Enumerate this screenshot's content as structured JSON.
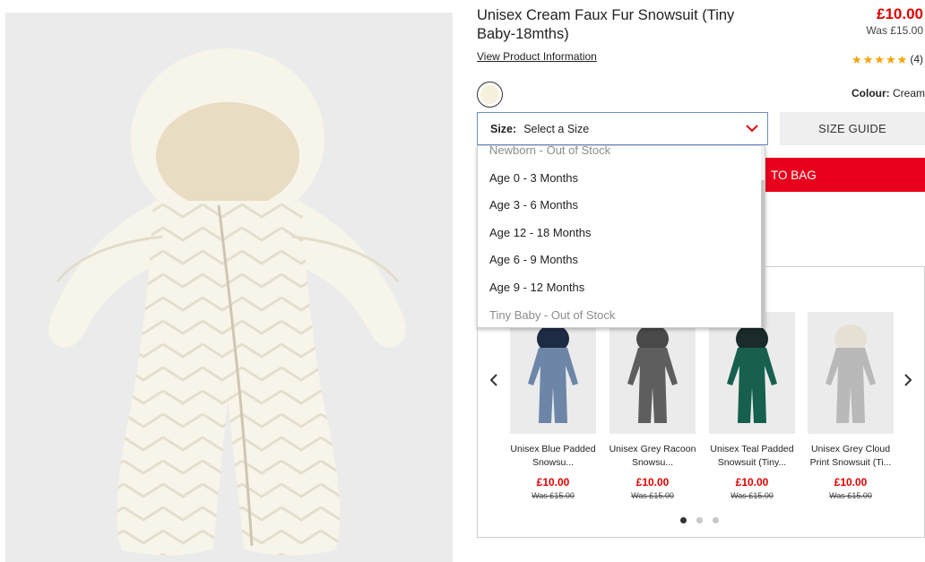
{
  "product": {
    "title": "Unisex Cream Faux Fur Snowsuit (Tiny Baby-18mths)",
    "view_info": "View Product Information",
    "price": "£10.00",
    "was_price": "Was £15.00",
    "rating_stars": 5,
    "rating_count": "(4)",
    "colour_label": "Colour:",
    "colour_value": "Cream",
    "swatch_color": "#f6f1dc"
  },
  "size": {
    "label": "Size:",
    "placeholder": "Select a Size",
    "guide_label": "SIZE GUIDE",
    "options": [
      {
        "label": "Newborn - Out of Stock",
        "available": false
      },
      {
        "label": "Age 0 - 3 Months",
        "available": true
      },
      {
        "label": "Age 3 - 6 Months",
        "available": true
      },
      {
        "label": "Age 12 - 18 Months",
        "available": true
      },
      {
        "label": "Age 6 - 9 Months",
        "available": true
      },
      {
        "label": "Age 9 - 12 Months",
        "available": true
      },
      {
        "label": "Tiny Baby - Out of Stock",
        "available": false
      }
    ]
  },
  "add_to_bag_label": "TO BAG",
  "carousel": {
    "items": [
      {
        "name": "Unisex Blue Padded Snowsu...",
        "price": "£10.00",
        "was": "Was £15.00",
        "color": "#6d86a8"
      },
      {
        "name": "Unisex Grey Racoon Snowsu...",
        "price": "£10.00",
        "was": "Was £15.00",
        "color": "#5e5e5e"
      },
      {
        "name": "Unisex Teal Padded Snowsuit (Tiny...",
        "price": "£10.00",
        "was": "Was £15.00",
        "color": "#16604d"
      },
      {
        "name": "Unisex Grey Cloud Print Snowsuit (Ti...",
        "price": "£10.00",
        "was": "Was £15.00",
        "color": "#b9b9b9"
      }
    ],
    "page_count": 3,
    "active_page": 1
  },
  "colors": {
    "accent_red": "#e8001c",
    "price_red": "#e00000",
    "star": "#f4a300"
  }
}
